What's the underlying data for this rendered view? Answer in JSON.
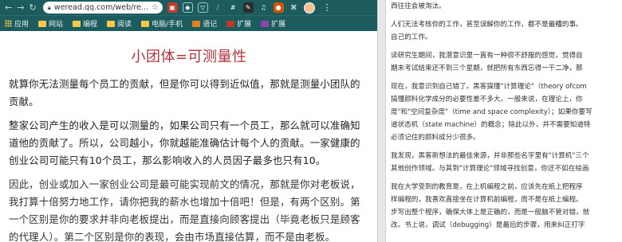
{
  "browser": {
    "url": "weread.qq.com/web/re...",
    "bookmarks": [
      "应用",
      "网站",
      "编程",
      "阅读",
      "电脑/手机",
      "语记",
      "扩展",
      "扩展"
    ]
  },
  "article": {
    "title": "小团体=可测量性",
    "paragraphs": [
      "就算你无法测量每个员工的贡献，但是你可以得到近似值，那就是测量小团队的贡献。",
      "整家公司产生的收入是可以测量的，如果公司只有一个员工，那么就可以准确知道他的贡献了。所以，公司越小，你就越能准确估计每个人的贡献。一家健康的创业公司可能只有10个员工，那么影响收入的人员因子最多也只有10。",
      "因此，创业或加入一家创业公司是最可能实现前文的情况，那就是你对老板说，我打算十倍努力地工作，请你把我的薪水也增加十倍吧！但是，有两个区别。第一个区别是你的要求并非向老板提出，而是直接向顾客提出（毕竟老板只是顾客的代理人）。第二个区别是你的表现，会由市场直接估算，而不是由老板。"
    ]
  },
  "right_pane": {
    "lines": [
      "西往往会被淘汰。",
      "",
      "人们无法考核你的工作，甚至误解你的工作，都不是最糟的事。",
      "自己的工作。",
      "",
      "读研究生期间，我潜意识里一直有一种很不舒服的感觉，觉得自",
      "期末考试结束还不到三个星期，就把所有东西忘得一干二净，那",
      "",
      "现在，我意识到自己错了。黑客搞懂\"计算理论\"（theory ofcom",
      "搞懂颜料化学成分的必要性差不多大。一般来说，在理论上，你",
      "度\"和\"空间复杂度\"（time and space complexity）；如果你要写",
      "道状态机（state machine）的概念；除此以外，并不需要知道特",
      "必须记住的颜料成分少很多。",
      "",
      "我发现，黑客新想法的最佳来源，并非那些名字里有\"计算机\"三个",
      "其他创作领域。与其到\"计算理论\"领域寻找创意，你还不如在绘画",
      "",
      "我在大学受到的教育是，在上机编程之前，应该先在纸上把程序",
      "样编程的，我喜欢直接坐在计算机前编程，而不是在纸上编程。",
      "步写出整个程序，确保大体上是正确的，而是一般脑不管对错，就",
      "改。书上说，调试（debugging）是最后的步骤，用来纠正打字"
    ]
  }
}
